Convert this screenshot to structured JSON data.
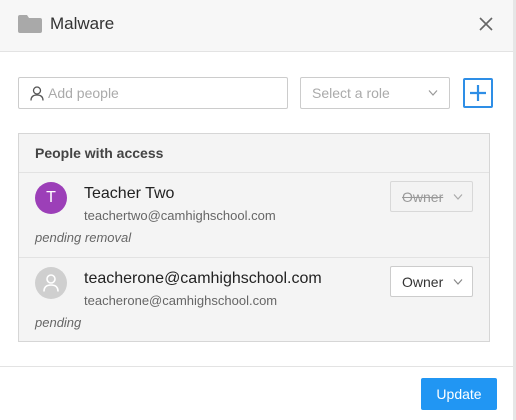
{
  "dialog": {
    "title": "Malware"
  },
  "add_people": {
    "placeholder": "Add people",
    "role_placeholder": "Select a role"
  },
  "panel": {
    "title": "People with access",
    "entries": [
      {
        "initial": "T",
        "name": "Teacher Two",
        "email": "teachertwo@camhighschool.com",
        "status": "pending removal",
        "role": "Owner"
      },
      {
        "initial": "",
        "name": "teacherone@camhighschool.com",
        "email": "teacherone@camhighschool.com",
        "status": "pending",
        "role": "Owner"
      }
    ]
  },
  "footer": {
    "update_label": "Update"
  },
  "colors": {
    "accent": "#2196f3",
    "avatar_purple": "#9c3fb8",
    "avatar_grey": "#cfcfcf"
  },
  "icons": {
    "header": "folder-icon",
    "close": "close-icon",
    "input": "person-icon",
    "select": "chevron-down-icon",
    "add": "plus-icon"
  }
}
